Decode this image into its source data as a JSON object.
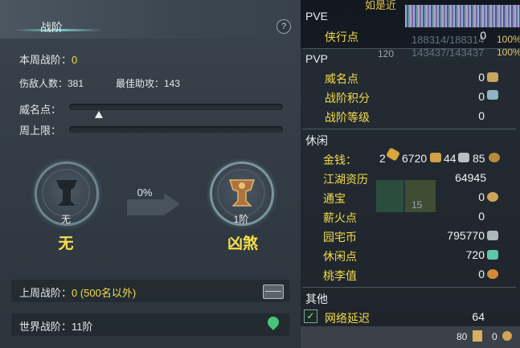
{
  "left_panel": {
    "title": "战阶",
    "help_label": "?",
    "weekly_rank": {
      "label": "本周战阶：",
      "value": "0"
    },
    "stats": {
      "kills": "伤敌人数：381",
      "best_assist": "最佳助攻：143"
    },
    "prestige": {
      "label": "威名点：",
      "progress": 0.14
    },
    "weekly_cap": {
      "label": "周上限：",
      "progress": 0
    },
    "current_tier": {
      "level": "无",
      "name": "无"
    },
    "progress_text": "0%",
    "next_tier": {
      "level": "1阶",
      "name": "凶煞"
    },
    "last_week": {
      "label": "上周战阶：",
      "value": "0 (500名以外)"
    },
    "world_rank": {
      "label": "世界战阶：",
      "value": "11阶"
    }
  },
  "right_panel": {
    "top_fragment": "如是近",
    "hp_numbers": [
      "188314/188314",
      "143437/143437"
    ],
    "hp_pct": [
      "100%",
      "100%"
    ],
    "badge_num": "120",
    "pve": {
      "title": "PVE",
      "items": [
        {
          "label": "侠行点",
          "value": "0"
        }
      ]
    },
    "pvp": {
      "title": "PVP",
      "items": [
        {
          "label": "威名点",
          "value": "0"
        },
        {
          "label": "战阶积分",
          "value": "0"
        },
        {
          "label": "战阶等级",
          "value": "0"
        }
      ]
    },
    "leisure": {
      "title": "休闲",
      "money_label": "金钱：",
      "money_values": [
        "2",
        "6720",
        "44",
        "85"
      ],
      "items": [
        {
          "label": "江湖资历",
          "value": "64945"
        },
        {
          "label": "通宝",
          "value": "0"
        },
        {
          "label": "薪火点",
          "value": "0"
        },
        {
          "label": "园宅币",
          "value": "795770"
        },
        {
          "label": "休闲点",
          "value": "720"
        },
        {
          "label": "桃李值",
          "value": "0"
        }
      ],
      "bag_slot_count": "15"
    },
    "other": {
      "title": "其他",
      "latency_label": "网络延迟",
      "latency_value": "64",
      "latency_checked": "✓"
    },
    "footer": {
      "left_value": "80",
      "right_value": "0"
    }
  },
  "colors": {
    "accent_yellow": "#f2dc4a",
    "panel_bg": "#333c45"
  }
}
